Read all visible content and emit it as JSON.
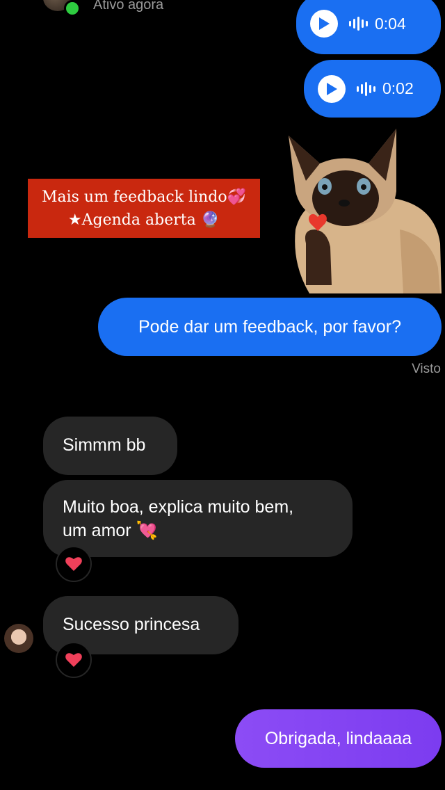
{
  "header": {
    "status": "Ativo agora"
  },
  "messages": {
    "voice_1_duration": "0:04",
    "voice_2_duration": "0:02",
    "story_line1": "Mais um feedback lindo💞",
    "story_line2": "★Agenda aberta 🔮",
    "sent_request": "Pode dar um feedback, por favor?",
    "seen_label": "Visto",
    "received_1": "Simmm bb",
    "received_2_line1": "Muito boa, explica muito bem,",
    "received_2_line2": "um amor 💘",
    "received_3": "Sucesso princesa",
    "sent_thanks": "Obrigada, lindaaaa"
  },
  "colors": {
    "background": "#000000",
    "sent_bubble": "#1a6ff2",
    "received_bubble": "#262626",
    "purple_bubble": "#8c4cf5",
    "story_card": "#c9280f",
    "online": "#2ecc40"
  }
}
